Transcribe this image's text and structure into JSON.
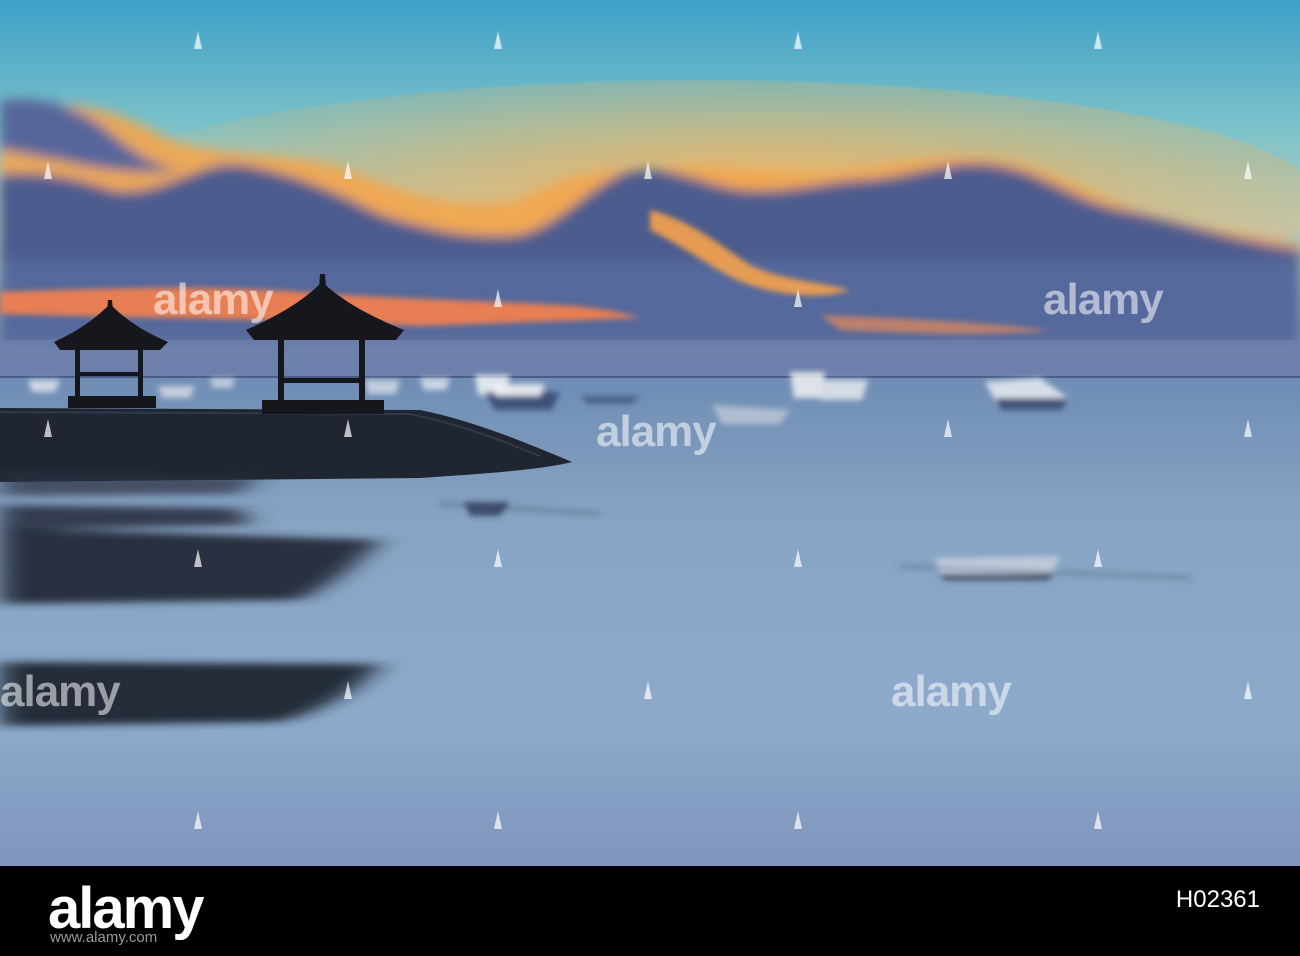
{
  "photo": {
    "subject": "sunset-seascape-with-gazebos-and-boats"
  },
  "watermark": {
    "text": "alamy"
  },
  "footer": {
    "logo": "alamy",
    "image_id": "H02361",
    "url": "www.alamy.com"
  },
  "colors": {
    "sky_top": "#3e9fc8",
    "sky_horizon": "#4a6c9a",
    "sunset_orange": "#f39a4a",
    "sea": "#8aa5c4",
    "footer_bg": "#000000"
  }
}
